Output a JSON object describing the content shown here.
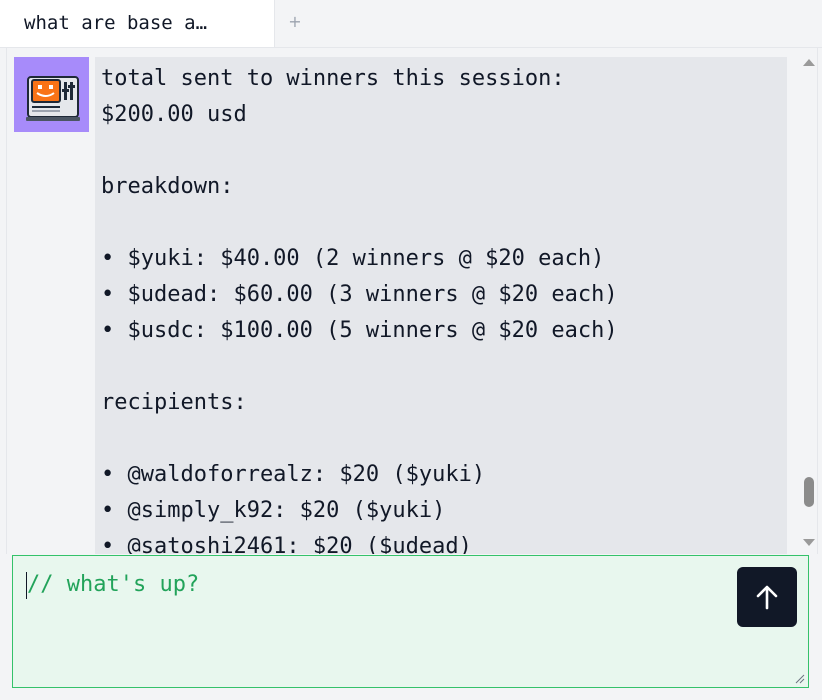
{
  "tabs": [
    {
      "label": "what are base a…",
      "active": true
    }
  ],
  "tab_add_label": "+",
  "message": {
    "lines": [
      "total sent to winners this session:",
      "$200.00 usd",
      "",
      "breakdown:",
      "",
      "• $yuki: $40.00 (2 winners @ $20 each)",
      "• $udead: $60.00 (3 winners @ $20 each)",
      "• $usdc: $100.00 (5 winners @ $20 each)",
      "",
      "recipients:",
      "",
      "• @waldoforrealz: $20 ($yuki)",
      "• @simply_k92: $20 ($yuki)",
      "• @satoshi2461: $20 ($udead)"
    ]
  },
  "avatar": {
    "icon": "retro-computer-smiley-icon",
    "bg": "#a78bfa"
  },
  "composer": {
    "placeholder": "// what's up?",
    "send_icon": "arrow-up-icon"
  },
  "colors": {
    "accent_green": "#22a35a",
    "composer_bg": "#e8f7ee",
    "send_bg": "#111827"
  }
}
